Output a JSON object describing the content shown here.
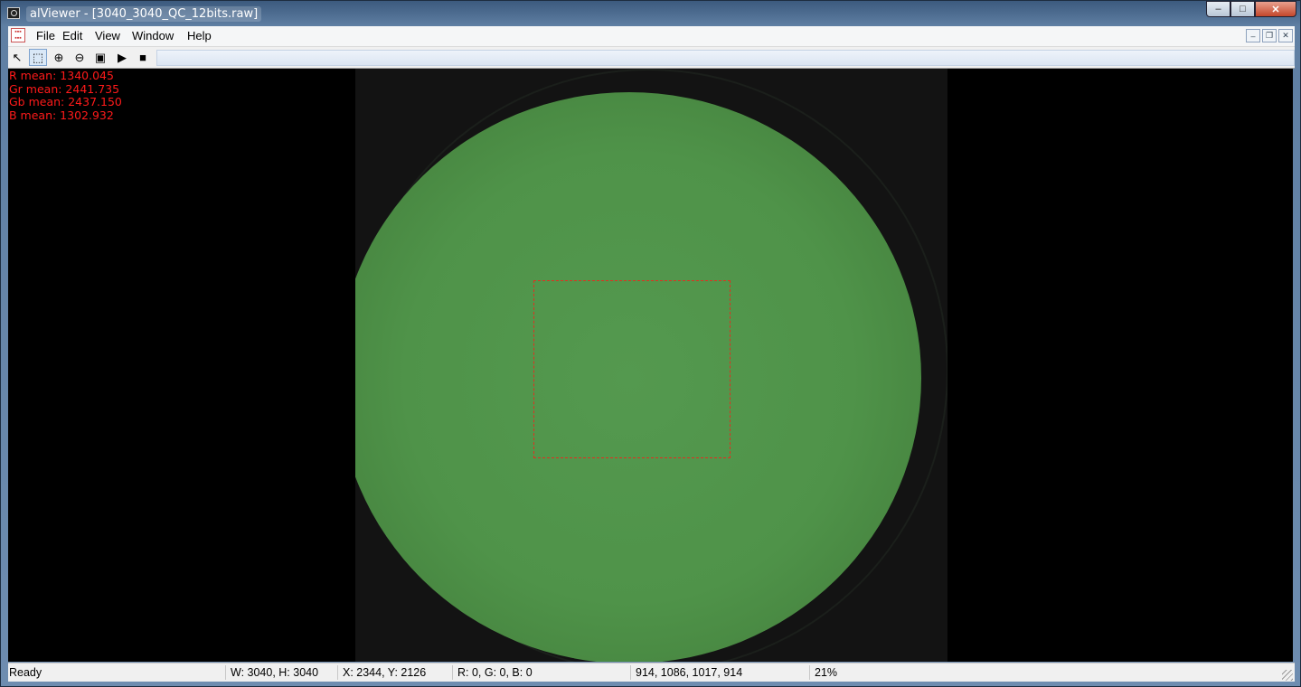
{
  "window": {
    "title": "alViewer - [3040_3040_QC_12bits.raw]",
    "caption_buttons": {
      "minimize": "–",
      "maximize": "□",
      "close": "✕"
    }
  },
  "menu": {
    "items": [
      "File",
      "Edit",
      "View",
      "Window",
      "Help"
    ],
    "mdi_buttons": {
      "minimize": "–",
      "restore": "❐",
      "close": "✕"
    }
  },
  "toolbar": {
    "tools": [
      {
        "icon": "pointer-arrow-icon",
        "glyph": "↖"
      },
      {
        "icon": "rect-select-icon",
        "glyph": "⬚"
      },
      {
        "icon": "zoom-in-icon",
        "glyph": "⊕"
      },
      {
        "icon": "zoom-out-icon",
        "glyph": "⊖"
      },
      {
        "icon": "fit-window-icon",
        "glyph": "▣"
      },
      {
        "icon": "play-icon",
        "glyph": "▶"
      },
      {
        "icon": "stop-icon",
        "glyph": "■"
      }
    ],
    "active_tool": "rect-select-icon"
  },
  "stats": {
    "r_mean": "R mean: 1340.045",
    "gr_mean": "Gr mean: 2441.735",
    "gb_mean": "Gb mean: 2437.150",
    "b_mean": "B mean: 1302.932"
  },
  "status": {
    "state": "Ready",
    "dimensions": "W: 3040, H: 3040",
    "cursor": "X: 2344, Y: 2126",
    "rgb": "R: 0, G: 0, B: 0",
    "roi": "914, 1086, 1017, 914",
    "zoom": "21%"
  },
  "colors": {
    "stats_text": "#ff1a1a",
    "roi_border": "#e03020",
    "lens_green": "#4f9349"
  }
}
